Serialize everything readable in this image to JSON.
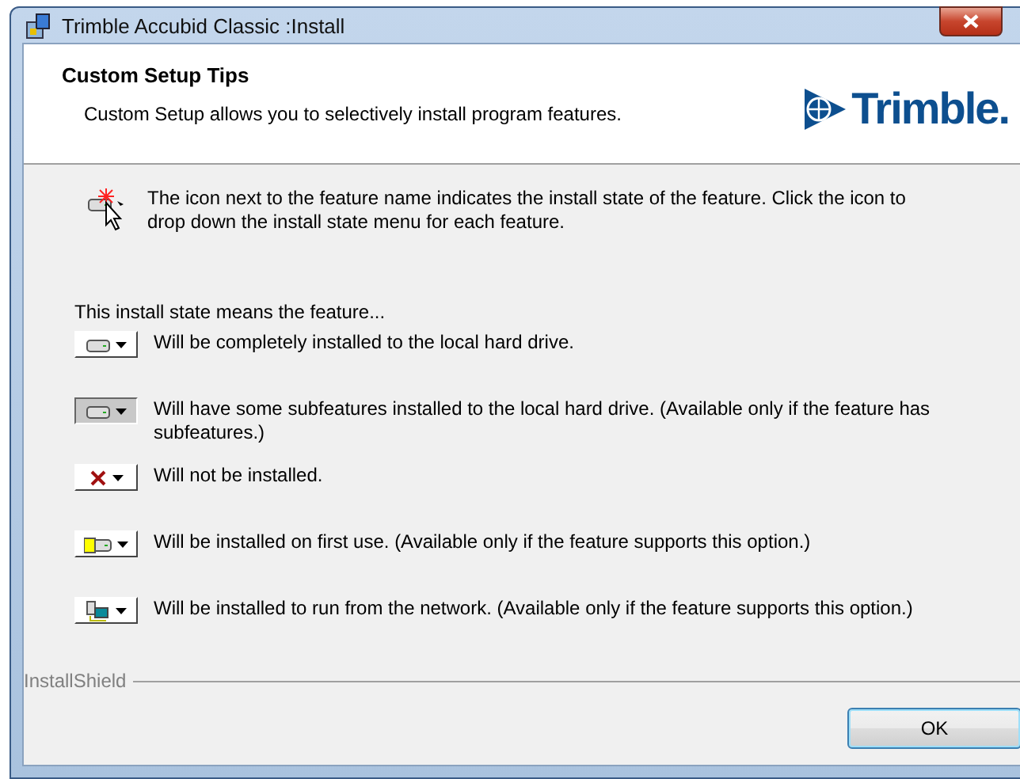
{
  "window": {
    "title": "Trimble Accubid Classic :Install"
  },
  "header": {
    "title": "Custom Setup Tips",
    "subtitle": "Custom Setup allows you to selectively install program features.",
    "logo": "Trimble."
  },
  "intro": "The icon next to the feature name indicates the install state of the feature. Click the icon to drop down the install state menu for each feature.",
  "states_heading": "This install state means the feature...",
  "states": [
    {
      "kind": "full",
      "text": "Will be completely installed to the local hard drive."
    },
    {
      "kind": "partial",
      "text": "Will have some subfeatures installed to the local hard drive. (Available only if the feature has subfeatures.)"
    },
    {
      "kind": "absent",
      "text": "Will not be installed."
    },
    {
      "kind": "first_use",
      "text": "Will be installed on first use. (Available only if the feature supports this option.)"
    },
    {
      "kind": "network",
      "text": "Will be installed to run from the network. (Available only if the feature supports this option.)"
    }
  ],
  "footer": {
    "brand": "InstallShield",
    "buttons": [
      "OK"
    ]
  }
}
